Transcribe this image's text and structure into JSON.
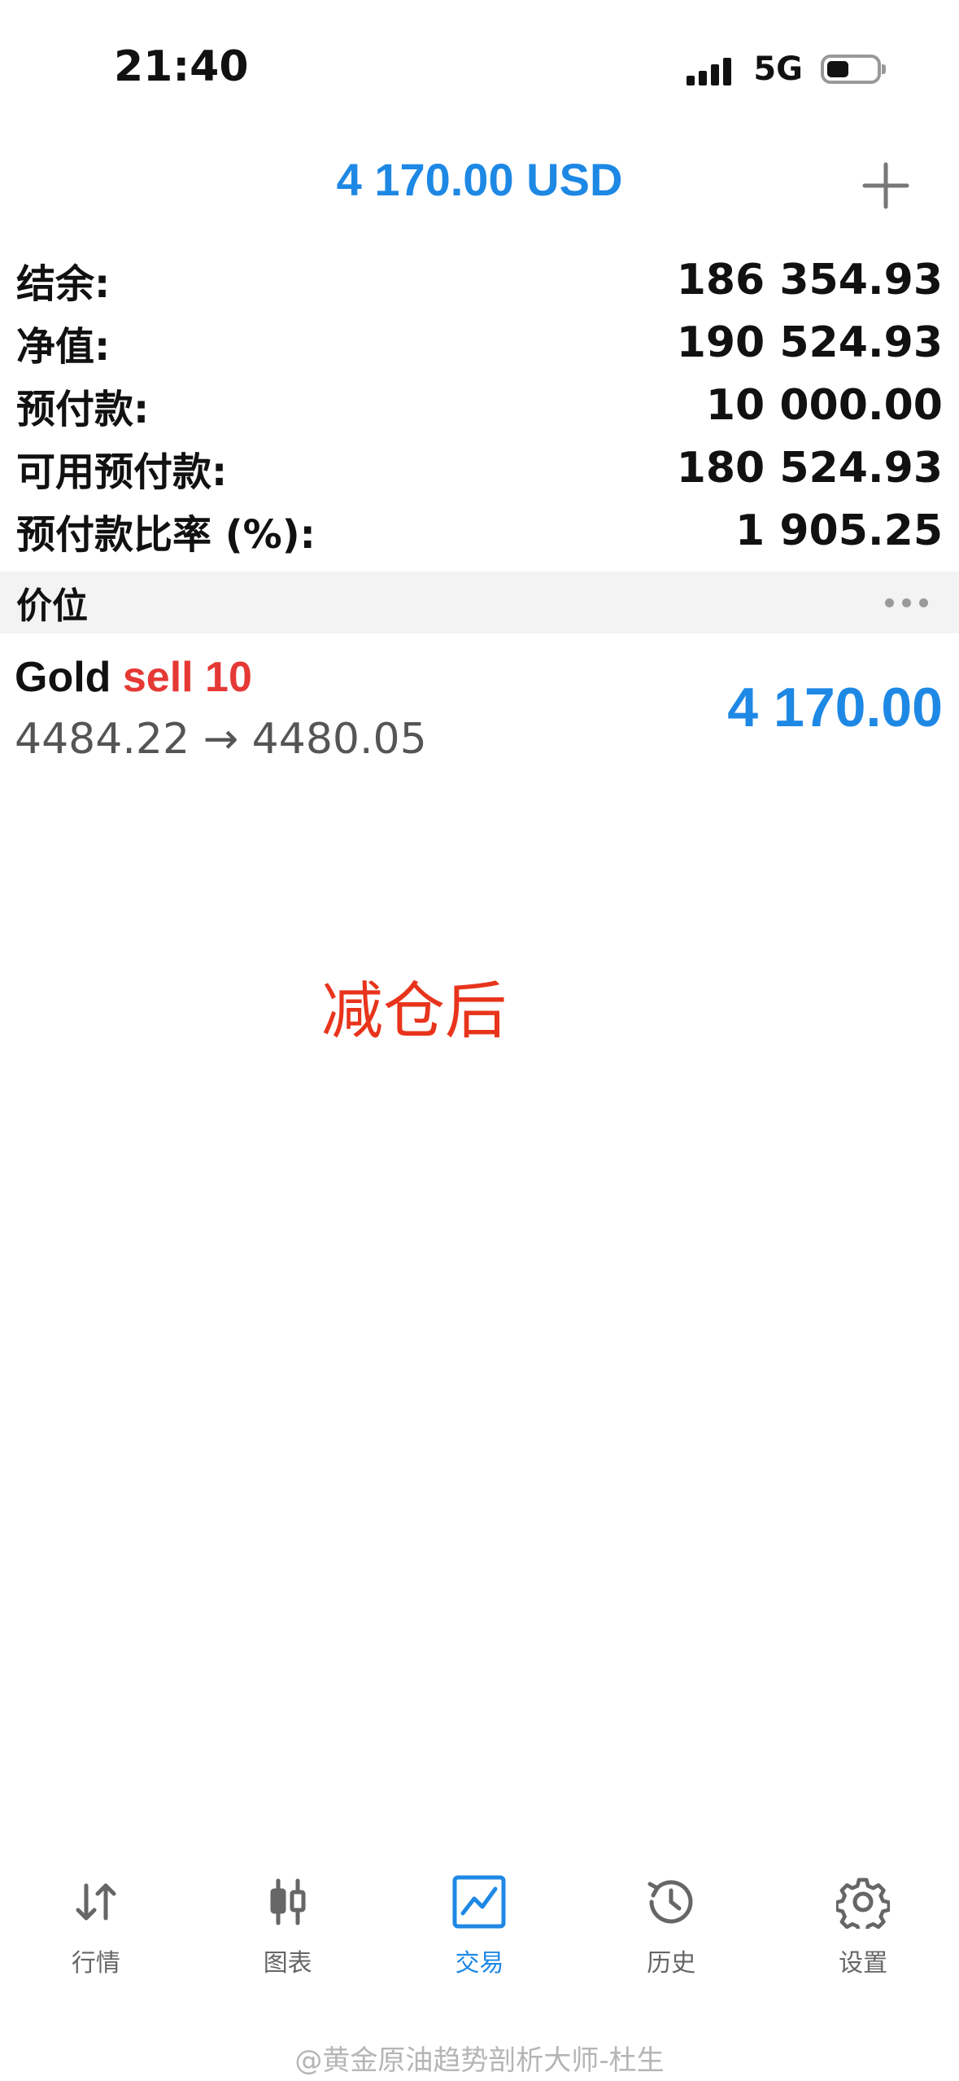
{
  "status_bar": {
    "time": "21:40",
    "network": "5G"
  },
  "header": {
    "title": "4 170.00 USD"
  },
  "summary": [
    {
      "label": "结余:",
      "value": "186 354.93"
    },
    {
      "label": "净值:",
      "value": "190 524.93"
    },
    {
      "label": "预付款:",
      "value": "10 000.00"
    },
    {
      "label": "可用预付款:",
      "value": "180 524.93"
    },
    {
      "label": "预付款比率 (%):",
      "value": "1 905.25"
    }
  ],
  "section": {
    "title": "价位"
  },
  "position": {
    "symbol": "Gold",
    "side": "sell 10",
    "prices": "4484.22 → 4480.05",
    "profit": "4 170.00"
  },
  "annotation": {
    "text": "减仓后"
  },
  "bottom_nav": [
    {
      "label": "行情",
      "icon": "quotes-icon"
    },
    {
      "label": "图表",
      "icon": "chart-icon"
    },
    {
      "label": "交易",
      "icon": "trade-icon",
      "active": true
    },
    {
      "label": "历史",
      "icon": "history-icon"
    },
    {
      "label": "设置",
      "icon": "settings-icon"
    }
  ],
  "watermark": {
    "text": "@黄金原油趋势剖析大师-杜生"
  },
  "colors": {
    "accent": "#1e88e5",
    "sell": "#e53935",
    "annotation": "#e8341c"
  }
}
